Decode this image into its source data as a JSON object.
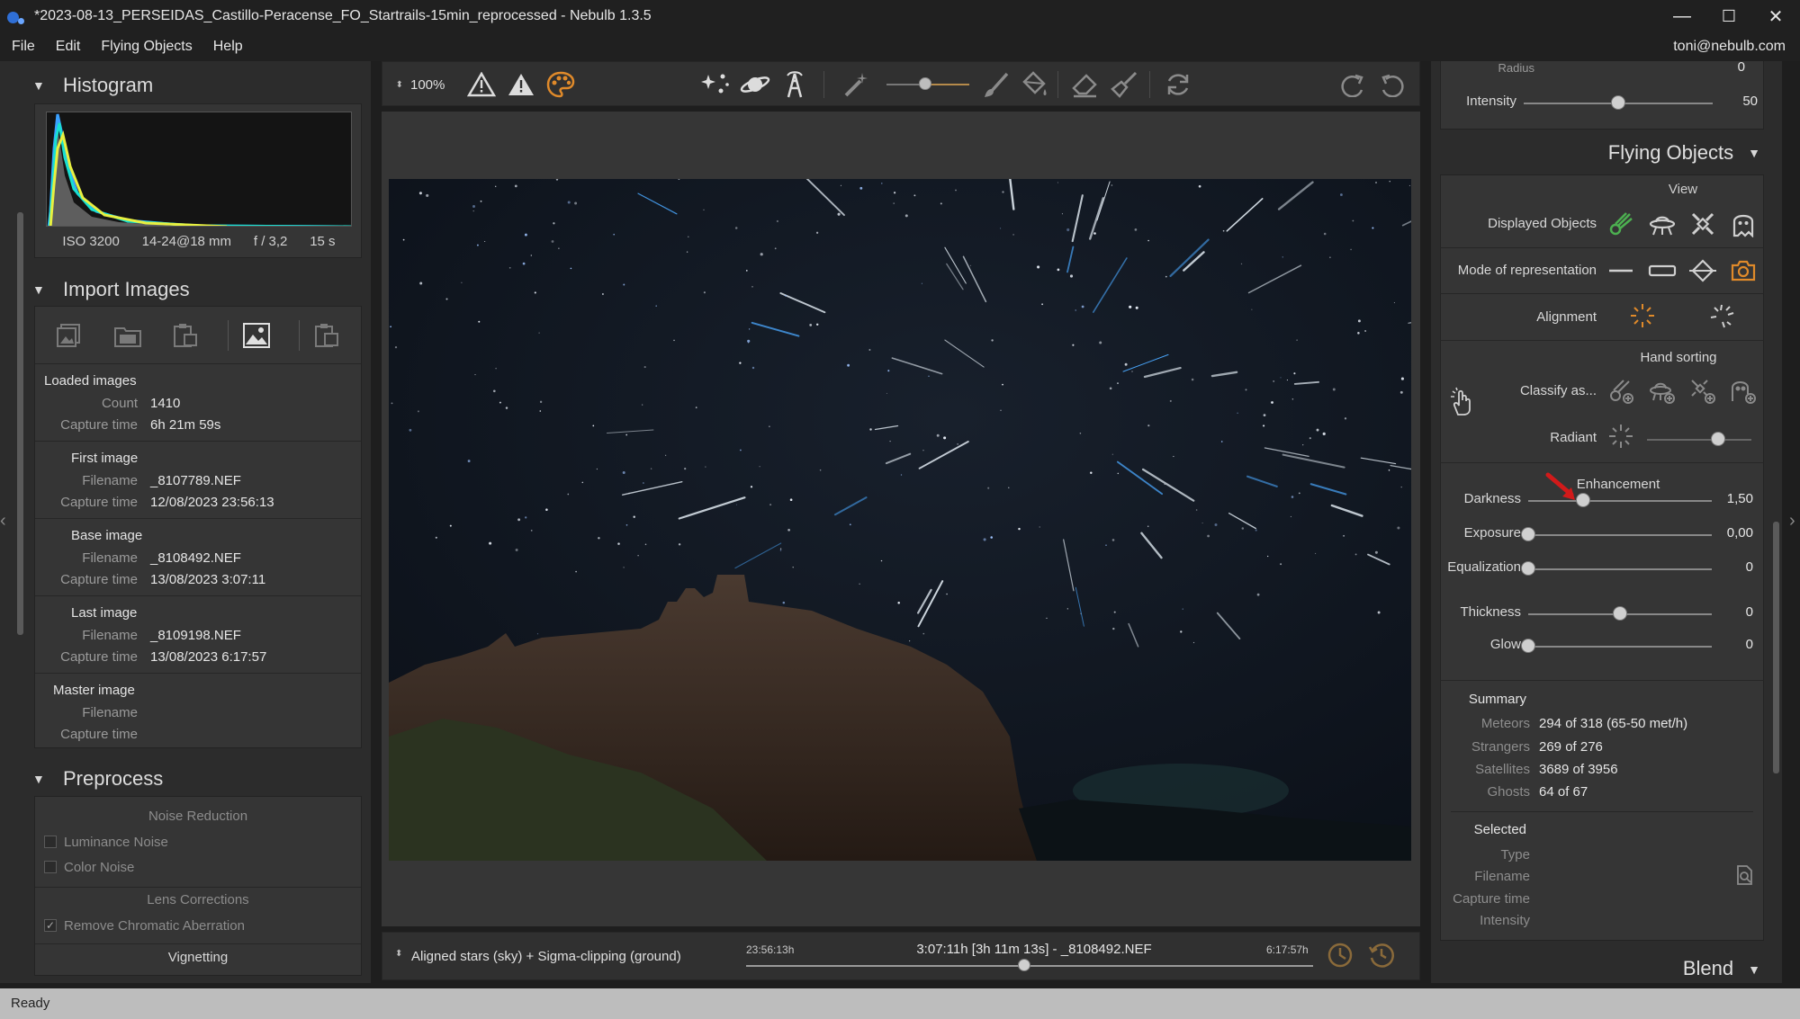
{
  "window": {
    "title": "*2023-08-13_PERSEIDAS_Castillo-Peracense_FO_Startrails-15min_reprocessed - Nebulb 1.3.5",
    "minimize": "—",
    "maximize": "☐",
    "close": "✕"
  },
  "menu": {
    "items": [
      "File",
      "Edit",
      "Flying Objects",
      "Help"
    ],
    "user": "toni@nebulb.com"
  },
  "left": {
    "histogram": {
      "title": "Histogram",
      "iso": "ISO 3200",
      "lens": "14-24@18 mm",
      "aperture": "f / 3,2",
      "exposure": "15 s"
    },
    "import": {
      "title": "Import Images",
      "loaded": {
        "title": "Loaded images",
        "count_label": "Count",
        "count": "1410",
        "capture_label": "Capture time",
        "capture": "6h 21m 59s"
      },
      "first": {
        "title": "First image",
        "filename_label": "Filename",
        "filename": "_8107789.NEF",
        "capture_label": "Capture time",
        "capture": "12/08/2023 23:56:13"
      },
      "base": {
        "title": "Base image",
        "filename_label": "Filename",
        "filename": "_8108492.NEF",
        "capture_label": "Capture time",
        "capture": "13/08/2023 3:07:11"
      },
      "last": {
        "title": "Last image",
        "filename_label": "Filename",
        "filename": "_8109198.NEF",
        "capture_label": "Capture time",
        "capture": "13/08/2023 6:17:57"
      },
      "master": {
        "title": "Master image",
        "filename_label": "Filename",
        "capture_label": "Capture time"
      }
    },
    "preprocess": {
      "title": "Preprocess",
      "noise_reduction": "Noise Reduction",
      "luminance_noise": "Luminance Noise",
      "color_noise": "Color Noise",
      "lens_corrections": "Lens Corrections",
      "remove_ca": "Remove Chromatic Aberration",
      "remove_ca_checked": true,
      "vignetting": "Vignetting"
    }
  },
  "toolbar": {
    "zoom": "100%"
  },
  "bottom": {
    "stack_mode": "Aligned stars (sky) + Sigma-clipping (ground)",
    "time_start": "23:56:13h",
    "time_center": "3:07:11h [3h 11m 13s] - _8108492.NEF",
    "time_end": "6:17:57h",
    "timeline_position": 0.49
  },
  "right": {
    "top": {
      "radius_label": "Radius",
      "radius_value": "0",
      "intensity_label": "Intensity",
      "intensity_value": "50",
      "intensity_pos": 0.5
    },
    "flying_objects": {
      "title": "Flying Objects",
      "view_title": "View",
      "displayed_objects": "Displayed Objects",
      "mode_of_representation": "Mode of representation",
      "alignment": "Alignment",
      "hand_sorting": "Hand sorting",
      "classify_as": "Classify as...",
      "radiant": "Radiant",
      "radiant_pos": 0.68,
      "enhancement_title": "Enhancement",
      "sliders": [
        {
          "label": "Darkness",
          "value": "1,50",
          "pos": 0.3
        },
        {
          "label": "Exposure",
          "value": "0,00",
          "pos": 0.0
        },
        {
          "label": "Equalization",
          "value": "0",
          "pos": 0.0
        },
        {
          "label": "Thickness",
          "value": "0",
          "pos": 0.5
        },
        {
          "label": "Glow",
          "value": "0",
          "pos": 0.0
        }
      ]
    },
    "summary": {
      "title": "Summary",
      "rows": [
        {
          "k": "Meteors",
          "v": "294 of 318 (65-50 met/h)"
        },
        {
          "k": "Strangers",
          "v": "269 of 276"
        },
        {
          "k": "Satellites",
          "v": "3689 of 3956"
        },
        {
          "k": "Ghosts",
          "v": "64 of 67"
        }
      ]
    },
    "selected": {
      "title": "Selected",
      "type": "Type",
      "filename": "Filename",
      "capture_time": "Capture time",
      "intensity": "Intensity"
    },
    "blend_title": "Blend"
  },
  "status": "Ready",
  "colors": {
    "accent_orange": "#e08a2a",
    "accent_green": "#4caf50",
    "annotation_red": "#d11a1a"
  }
}
